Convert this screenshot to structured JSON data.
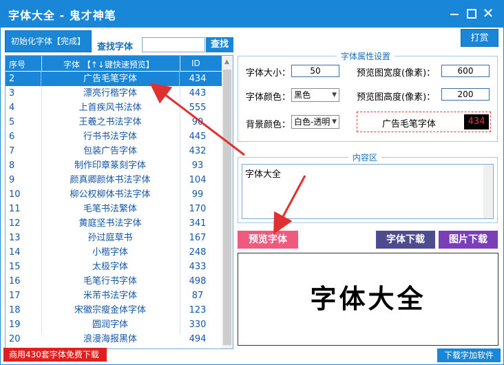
{
  "window": {
    "title": "字体大全 - 鬼才神笔",
    "close_glyph": "✕"
  },
  "toolbar": {
    "init_label": "初始化字体【完成】",
    "find_label": "查找字体",
    "find_value": "",
    "find_button": "查找",
    "tip_button": "打赏"
  },
  "list": {
    "headers": {
      "num": "序号",
      "font": "字体 【↑↓键快速预览】",
      "id": "ID"
    },
    "rows": [
      {
        "n": "2",
        "name": "广告毛笔字体",
        "id": "434"
      },
      {
        "n": "3",
        "name": "漂亮行楷字体",
        "id": "443"
      },
      {
        "n": "4",
        "name": "上首疾风书法体",
        "id": "555"
      },
      {
        "n": "5",
        "name": "王羲之书法字体",
        "id": "90"
      },
      {
        "n": "6",
        "name": "行书书法字体",
        "id": "445"
      },
      {
        "n": "7",
        "name": "包装广告字体",
        "id": "432"
      },
      {
        "n": "8",
        "name": "制作印章篆刻字体",
        "id": "93"
      },
      {
        "n": "9",
        "name": "颜真卿颜体书法字体",
        "id": "104"
      },
      {
        "n": "10",
        "name": "柳公权柳体书法字体",
        "id": "99"
      },
      {
        "n": "11",
        "name": "毛笔书法繁体",
        "id": "170"
      },
      {
        "n": "12",
        "name": "黄庭坚书法字体",
        "id": "341"
      },
      {
        "n": "13",
        "name": "孙过庭草书",
        "id": "167"
      },
      {
        "n": "14",
        "name": "小楷字体",
        "id": "248"
      },
      {
        "n": "15",
        "name": "太极字体",
        "id": "433"
      },
      {
        "n": "16",
        "name": "毛笔行书字体",
        "id": "498"
      },
      {
        "n": "17",
        "name": "米芾书法字体",
        "id": "87"
      },
      {
        "n": "18",
        "name": "宋徽宗瘦金体字体",
        "id": "123"
      },
      {
        "n": "19",
        "name": "圆润字体",
        "id": "330"
      },
      {
        "n": "20",
        "name": "浪漫海报黑体",
        "id": "494"
      }
    ],
    "selected_index": 0
  },
  "props": {
    "group_title": "字体属性设置",
    "size_label": "字体大小：",
    "size_value": "50",
    "width_label": "预览图宽度(像素)：",
    "width_value": "600",
    "color_label": "字体颜色：",
    "color_value": "黑色",
    "height_label": "预览图高度(像素)：",
    "height_value": "200",
    "bg_label": "背景颜色：",
    "bg_value": "白色-透明",
    "preview_name": "广告毛笔字体",
    "preview_id": "434"
  },
  "content": {
    "group_title": "内容区",
    "text": "字体大全"
  },
  "actions": {
    "preview": "预览字体",
    "download_font": "字体下载",
    "download_image": "图片下载"
  },
  "canvas": {
    "text": "字体大全"
  },
  "footer": {
    "promo": "商用430套字体免费下载",
    "download_plus": "下载字加软件"
  },
  "colors": {
    "accent": "#1a86d8",
    "preview_button": "#f05a7e",
    "download_font": "#4f4b8f",
    "download_image": "#7a3fb8",
    "promo": "#e02020",
    "arrow": "#e03030"
  }
}
